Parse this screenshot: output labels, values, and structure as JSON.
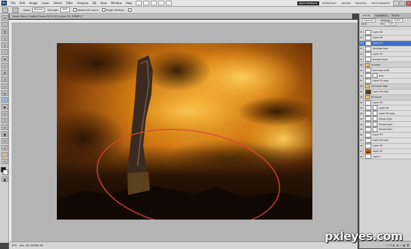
{
  "menubar": {
    "app_logo": "Ps",
    "items": [
      "File",
      "Edit",
      "Image",
      "Layer",
      "Select",
      "Filter",
      "Analysis",
      "3D",
      "View",
      "Window",
      "Help"
    ],
    "workspaces": {
      "active": "BARCODEBACK",
      "essentials": "ESSENTIALS",
      "design": "DESIGN",
      "painting": "PAINTING",
      "photography": "PHOTOGRAPHY"
    }
  },
  "options": {
    "mode_label": "Mode:",
    "mode_value": "Normal",
    "strength_label": "Strength:",
    "strength_value": "50%",
    "sample_all": "Sample All Layers",
    "finger_painting": "Finger Painting"
  },
  "document": {
    "tab_title": "Never Was a Crooked House @ 33.3% (Layer 53, RGB/8*) *",
    "zoom": "33%",
    "doc_size": "Doc: 40.2M/586.0M"
  },
  "panel": {
    "tabs": [
      "LAYERS",
      "CHANNELS",
      "PATHS"
    ],
    "blend_mode": "Normal",
    "opacity_label": "Opacity:",
    "opacity_value": "100%",
    "lock_label": "Lock:",
    "fill_label": "Fill:",
    "fill_value": "100%",
    "footer_icons": "∞ fx ◐ ◑ ▭ ▣ 🗑",
    "layers": [
      {
        "name": "Layer 36",
        "kind": "normal"
      },
      {
        "name": "Layer 48",
        "kind": "normal"
      },
      {
        "name": "Layer 53",
        "kind": "normal",
        "selected": true
      },
      {
        "name": "Smudge layer",
        "kind": "normal"
      },
      {
        "name": "Layer 45",
        "kind": "normal"
      },
      {
        "name": "monkey layer",
        "kind": "normal"
      },
      {
        "name": "all trees",
        "kind": "group"
      },
      {
        "name": "tree color shift",
        "kind": "normal"
      },
      {
        "name": "tree",
        "kind": "mask"
      },
      {
        "name": "Layer 55 copy",
        "kind": "normal"
      },
      {
        "name": "All house copy",
        "kind": "group"
      },
      {
        "name": "Layer 46 copy",
        "kind": "dark"
      },
      {
        "name": "All house",
        "kind": "group"
      },
      {
        "name": "Layer 38",
        "kind": "normal"
      },
      {
        "name": "Layer 38",
        "kind": "mask"
      },
      {
        "name": "Layer 38 copy",
        "kind": "mask"
      },
      {
        "name": "House layer",
        "kind": "mask"
      },
      {
        "name": "House layer...",
        "kind": "mask"
      },
      {
        "name": "House layer...",
        "kind": "mask"
      },
      {
        "name": "Layer 39",
        "kind": "normal"
      },
      {
        "name": "Layer 38 copy",
        "kind": "normal"
      },
      {
        "name": "Layer 49",
        "kind": "normal"
      },
      {
        "name": "Layer 44",
        "kind": "fire"
      },
      {
        "name": "Layer 1",
        "kind": "normal"
      }
    ]
  },
  "watermark": "pxleyes.com"
}
